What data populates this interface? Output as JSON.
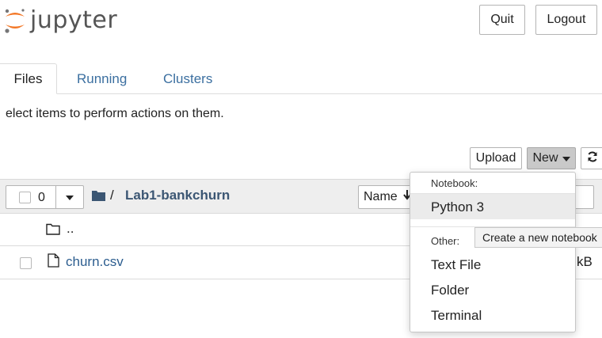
{
  "app": {
    "logo_text": "jupyter"
  },
  "header": {
    "quit_label": "Quit",
    "logout_label": "Logout"
  },
  "tabs": [
    {
      "label": "Files",
      "active": true
    },
    {
      "label": "Running",
      "active": false
    },
    {
      "label": "Clusters",
      "active": false
    }
  ],
  "toolbar": {
    "hint": "elect items to perform actions on them.",
    "upload_label": "Upload",
    "new_label": "New"
  },
  "list_header": {
    "selected_count": "0",
    "separator": "/",
    "current_folder": "Lab1-bankchurn",
    "sort_label": "Name"
  },
  "files": [
    {
      "name": "..",
      "type": "parent-folder"
    },
    {
      "name": "churn.csv",
      "type": "file",
      "size": "kB"
    }
  ],
  "new_menu": {
    "notebook_header": "Notebook:",
    "notebook_items": [
      "Python 3"
    ],
    "other_header": "Other:",
    "other_items": [
      "Text File",
      "Folder",
      "Terminal"
    ]
  },
  "tooltip": {
    "text": "Create a new notebook"
  },
  "colors": {
    "link": "#3b6fa0",
    "logo_orange": "#f37726"
  },
  "icons": [
    "logo-icon",
    "caret-down-icon",
    "refresh-icon",
    "folder-icon",
    "folder-outline-icon",
    "file-icon",
    "sort-down-icon"
  ]
}
